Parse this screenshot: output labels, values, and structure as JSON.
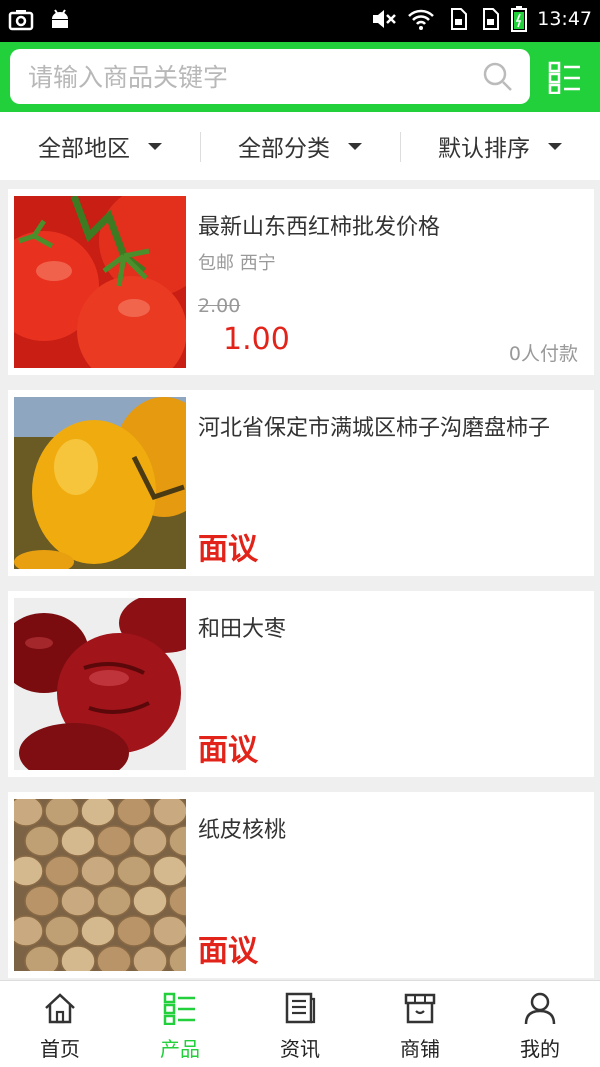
{
  "status_bar": {
    "time": "13:47"
  },
  "search": {
    "placeholder": "请输入商品关键字"
  },
  "filters": [
    {
      "label": "全部地区"
    },
    {
      "label": "全部分类"
    },
    {
      "label": "默认排序"
    }
  ],
  "products": [
    {
      "title": "最新山东西红柿批发价格",
      "meta": "包邮 西宁",
      "old_price": "2.00",
      "price": "1.00",
      "sold": "0人付款",
      "image": "tomato"
    },
    {
      "title": "河北省保定市满城区柿子沟磨盘柿子",
      "price_text": "面议",
      "image": "persimmon"
    },
    {
      "title": "和田大枣",
      "price_text": "面议",
      "image": "red-dates"
    },
    {
      "title": "纸皮核桃",
      "price_text": "面议",
      "image": "walnuts"
    }
  ],
  "tabbar": {
    "items": [
      {
        "label": "首页",
        "icon": "home-icon"
      },
      {
        "label": "产品",
        "icon": "products-grid-icon"
      },
      {
        "label": "资讯",
        "icon": "news-icon"
      },
      {
        "label": "商铺",
        "icon": "shop-icon"
      },
      {
        "label": "我的",
        "icon": "user-icon"
      }
    ],
    "active_index": 1
  },
  "colors": {
    "brand_green": "#22d03c",
    "price_red": "#e2231a"
  }
}
